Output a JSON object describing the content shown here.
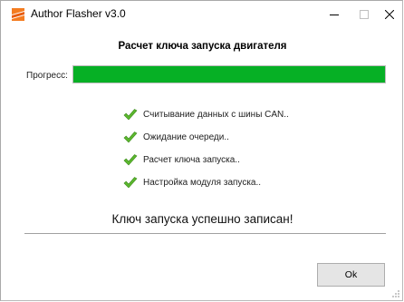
{
  "window": {
    "title": "Author Flasher v3.0",
    "controls": [
      "minimize-icon",
      "maximize-icon",
      "close-icon"
    ]
  },
  "heading": "Расчет ключа запуска двигателя",
  "progress": {
    "label": "Прогресс:",
    "percent": 100,
    "color": "#06b025"
  },
  "steps": [
    {
      "icon": "checkmark-icon",
      "label": "Считывание данных с шины CAN.."
    },
    {
      "icon": "checkmark-icon",
      "label": "Ожидание очереди.."
    },
    {
      "icon": "checkmark-icon",
      "label": "Расчет ключа запуска.."
    },
    {
      "icon": "checkmark-icon",
      "label": "Настройка модуля запуска.."
    }
  ],
  "result_message": "Ключ запуска успешно записан!",
  "ok_button": {
    "label": "Ok"
  }
}
